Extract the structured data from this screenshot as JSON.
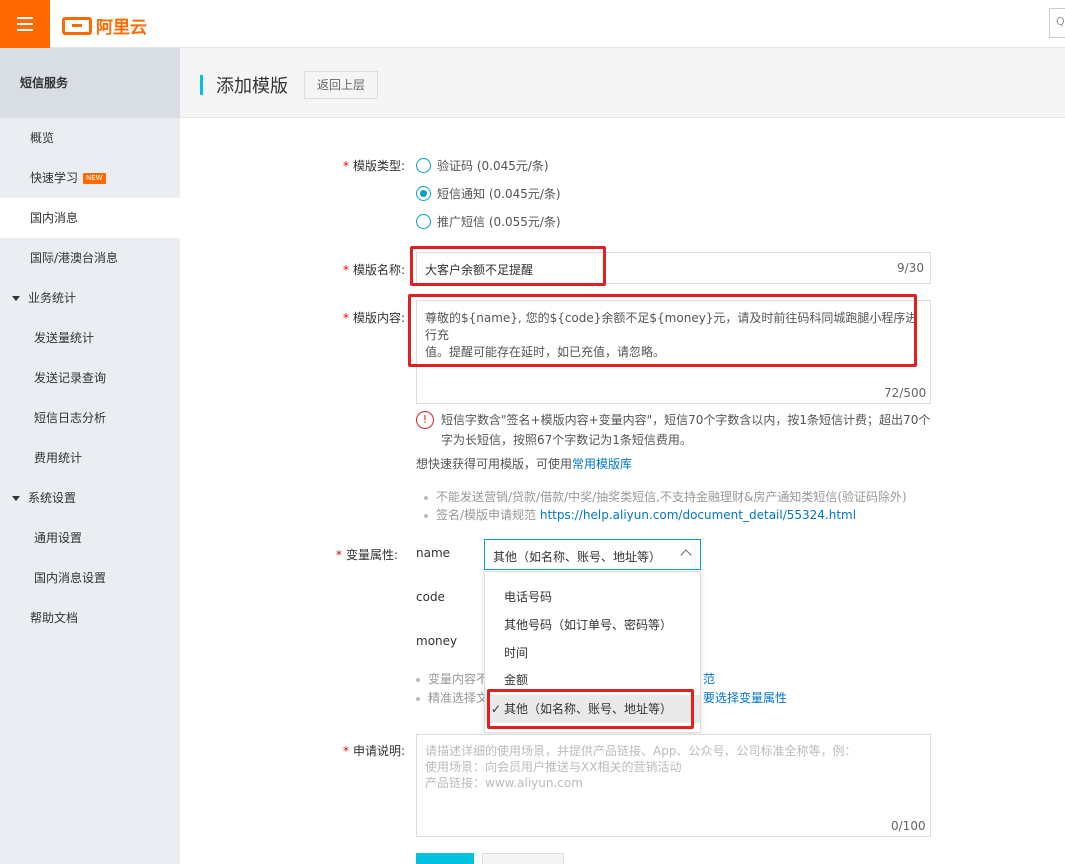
{
  "topbar": {
    "logo_text": "阿里云",
    "right_text": "Q"
  },
  "sidebar": {
    "header": "短信服务",
    "items": [
      {
        "label": "概览"
      },
      {
        "label": "快速学习",
        "badge": "NEW"
      },
      {
        "label": "国内消息"
      },
      {
        "label": "国际/港澳台消息"
      },
      {
        "label": "业务统计"
      },
      {
        "label": "发送量统计"
      },
      {
        "label": "发送记录查询"
      },
      {
        "label": "短信日志分析"
      },
      {
        "label": "费用统计"
      },
      {
        "label": "系统设置"
      },
      {
        "label": "通用设置"
      },
      {
        "label": "国内消息设置"
      },
      {
        "label": "帮助文档"
      }
    ]
  },
  "page": {
    "title": "添加模版",
    "back_button": "返回上层"
  },
  "form": {
    "type_label": "模版类型:",
    "type_options": [
      {
        "label": "验证码 (0.045元/条)",
        "checked": false
      },
      {
        "label": "短信通知 (0.045元/条)",
        "checked": true
      },
      {
        "label": "推广短信 (0.055元/条)",
        "checked": false
      }
    ],
    "name_label": "模版名称:",
    "name_value": "大客户余额不足提醒",
    "name_counter": "9/30",
    "content_label": "模版内容:",
    "content_line1": "尊敬的${name}, 您的${code}余额不足${money}元，请及时前往码科同城跑腿小程序进行充",
    "content_line2": "值。提醒可能存在延时，如已充值，请忽略。",
    "content_counter": "72/500",
    "info_line1": "短信字数含\"签名+模版内容+变量内容\"，短信70个字数含以内，按1条短信计费；超出70个",
    "info_line2": "字为长短信，按照67个字数记为1条短信费用。",
    "quick_text": "想快速获得可用模版，可使用",
    "quick_link": "常用模版库",
    "bullet1": "不能发送营销/贷款/借款/中奖/抽奖类短信,不支持金融理财&房产通知类短信(验证码除外)",
    "bullet2_text": "签名/模版申请规范 ",
    "bullet2_link": "https://help.aliyun.com/document_detail/55324.html",
    "var_label": "变量属性:",
    "vars": [
      "name",
      "code",
      "money"
    ],
    "var_select_value": "其他（如名称、账号、地址等）",
    "var_options": [
      "电话号码",
      "其他号码（如订单号、密码等）",
      "时间",
      "金额",
      "其他（如名称、账号、地址等）"
    ],
    "var_bullet1_text": "变量内容不",
    "var_bullet1_link": "范",
    "var_bullet2_text": "精准选择文",
    "var_bullet2_link": "要选择变量属性",
    "desc_label": "申请说明:",
    "desc_placeholder_1": "请描述详细的使用场景，并提供产品链接、App、公众号、公司标准全称等，例：",
    "desc_placeholder_2": "使用场景：向会员用户推送与XX相关的营销活动",
    "desc_placeholder_3": "产品链接：www.aliyun.com",
    "desc_counter": "0/100"
  },
  "colors": {
    "brand": "#ff6a00",
    "accent": "#00c1de",
    "highlight": "#e02020"
  }
}
